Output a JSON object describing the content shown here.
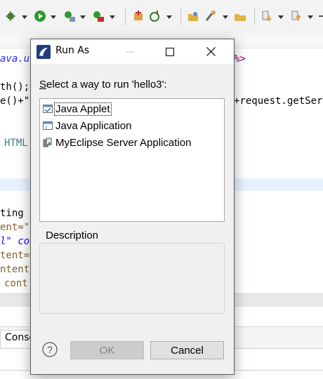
{
  "background": {
    "toolbar_icons": [
      "debug-icon",
      "run-icon",
      "coverage-icon",
      "external-tools-icon",
      "new-server-icon",
      "new-project-icon",
      "open-type-icon",
      "search-icon",
      "open-folder-icon",
      "next-annotation-icon",
      "previous-annotation-icon"
    ],
    "code_lines": [
      "ava.u",
      "%>",
      "th();",
      "e()+\"",
      "+request.getSer",
      "HTML",
      "ting",
      "ent=\"",
      "l\" co",
      "tent=",
      "ntent",
      "cont"
    ],
    "console_tab_label": "Conso"
  },
  "dialog": {
    "title": "Run As",
    "prompt": "Select a way to run 'hello3':",
    "items": [
      {
        "label": "Java Applet",
        "icon": "java-applet-icon",
        "selected": true
      },
      {
        "label": "Java Application",
        "icon": "java-application-icon",
        "selected": false
      },
      {
        "label": "MyEclipse Server Application",
        "icon": "server-application-icon",
        "selected": false
      }
    ],
    "description_label": "Description",
    "description_text": "",
    "help_label": "?",
    "ok_label": "OK",
    "cancel_label": "Cancel"
  },
  "colors": {
    "dialog_bg": "#f0f0f0",
    "selection_bg": "#ffffff",
    "ok_disabled_bg": "#cccccc",
    "code_highlight": "#e8f2fe",
    "string_purple": "#7f0055"
  }
}
